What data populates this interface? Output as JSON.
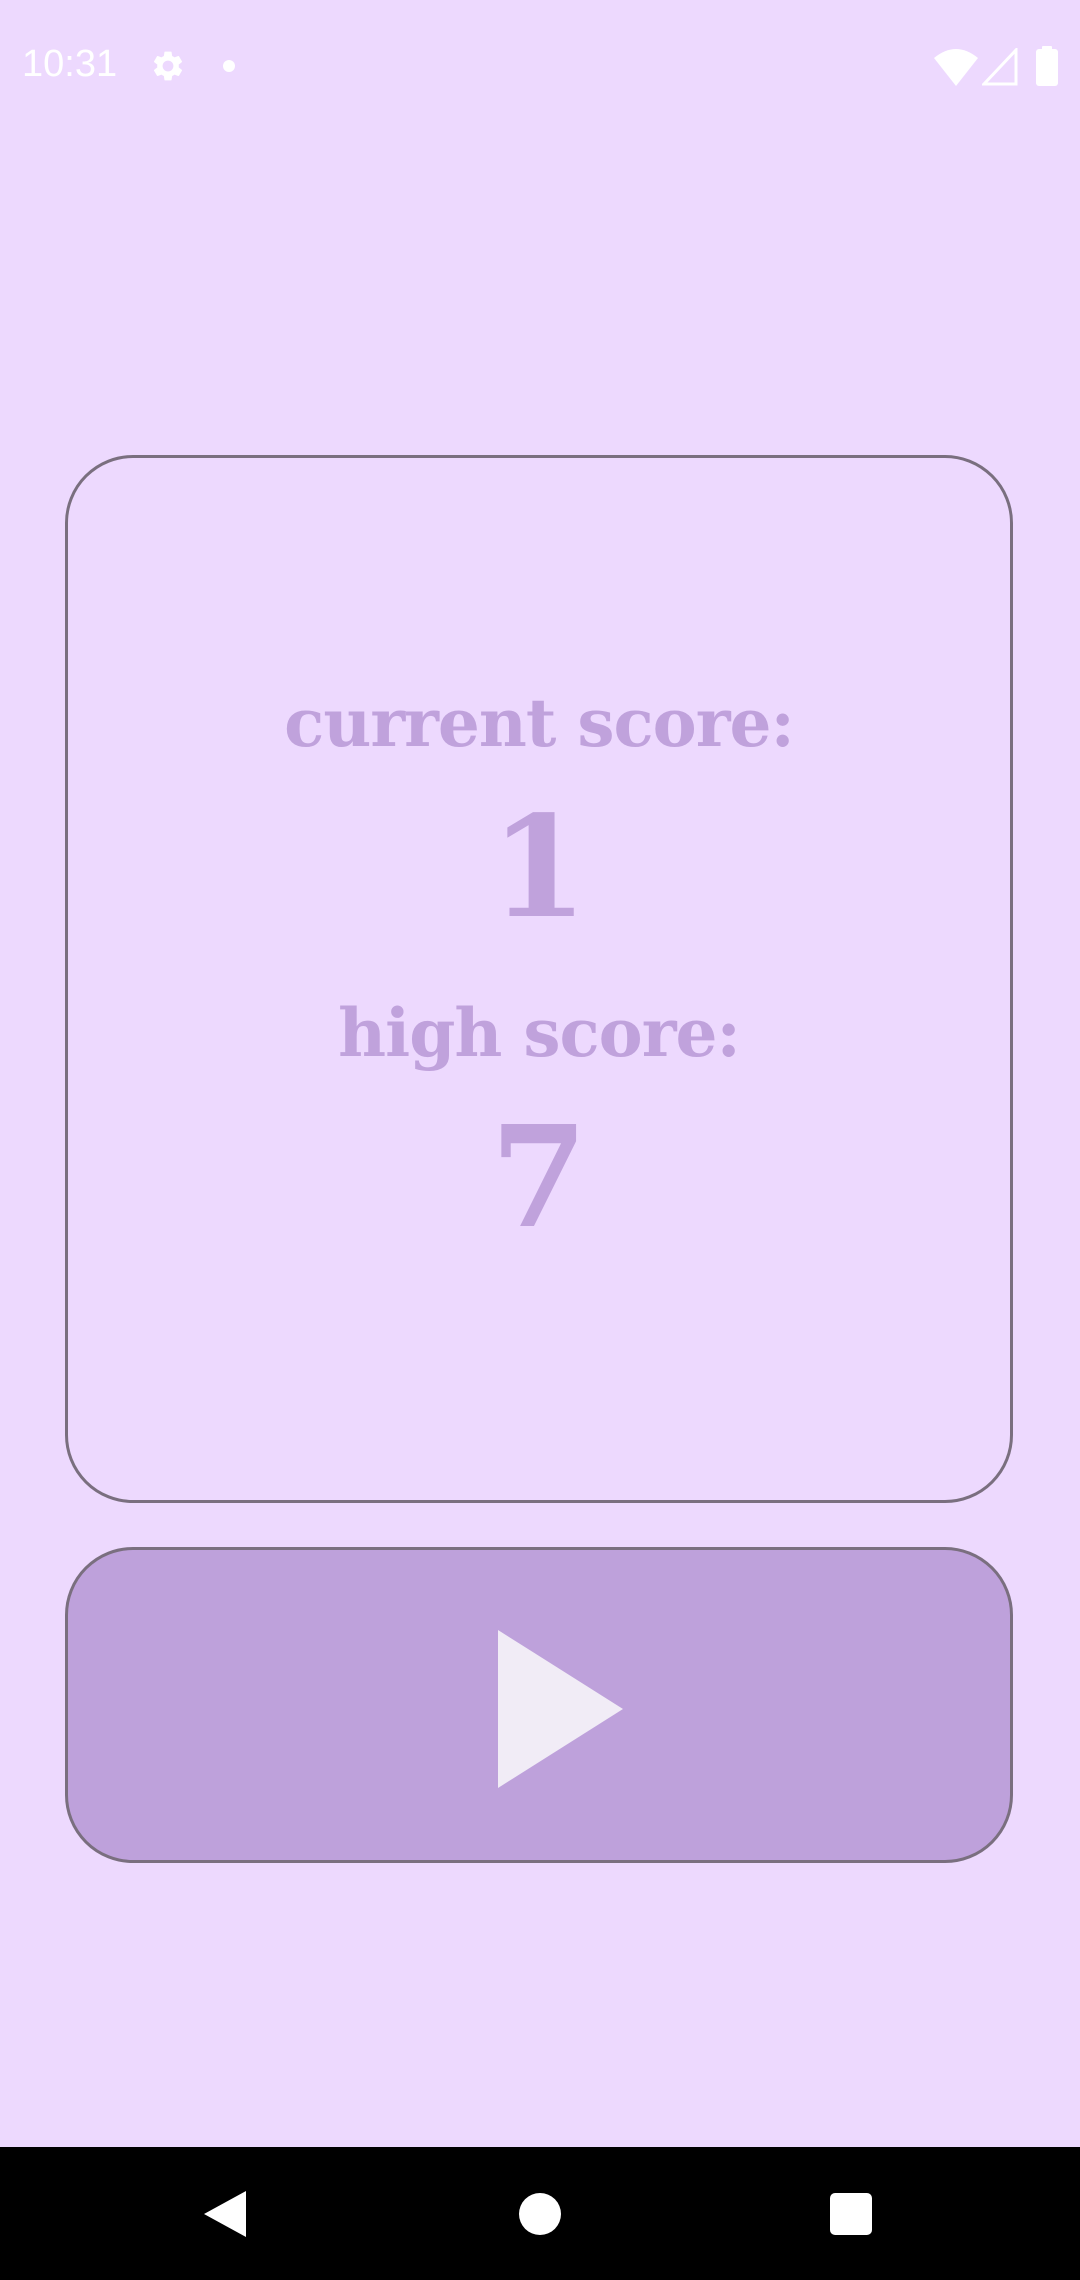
{
  "status_bar": {
    "time": "10:31",
    "icons": [
      "gear-icon",
      "notification-dot-icon",
      "wifi-icon",
      "cell-signal-icon",
      "battery-icon"
    ]
  },
  "score_card": {
    "current_label": "current score:",
    "current_value": "1",
    "high_label": "high score:",
    "high_value": "7"
  },
  "play_button": {
    "icon": "play-icon"
  },
  "nav_bar": {
    "buttons": [
      "back-icon",
      "home-icon",
      "recents-icon"
    ]
  },
  "colors": {
    "background": "#EDD9FE",
    "text_accent": "#C0A2DC",
    "button_fill": "#BEA1DB",
    "border": "#7A6F7F",
    "play_icon": "#F1ECF6"
  }
}
